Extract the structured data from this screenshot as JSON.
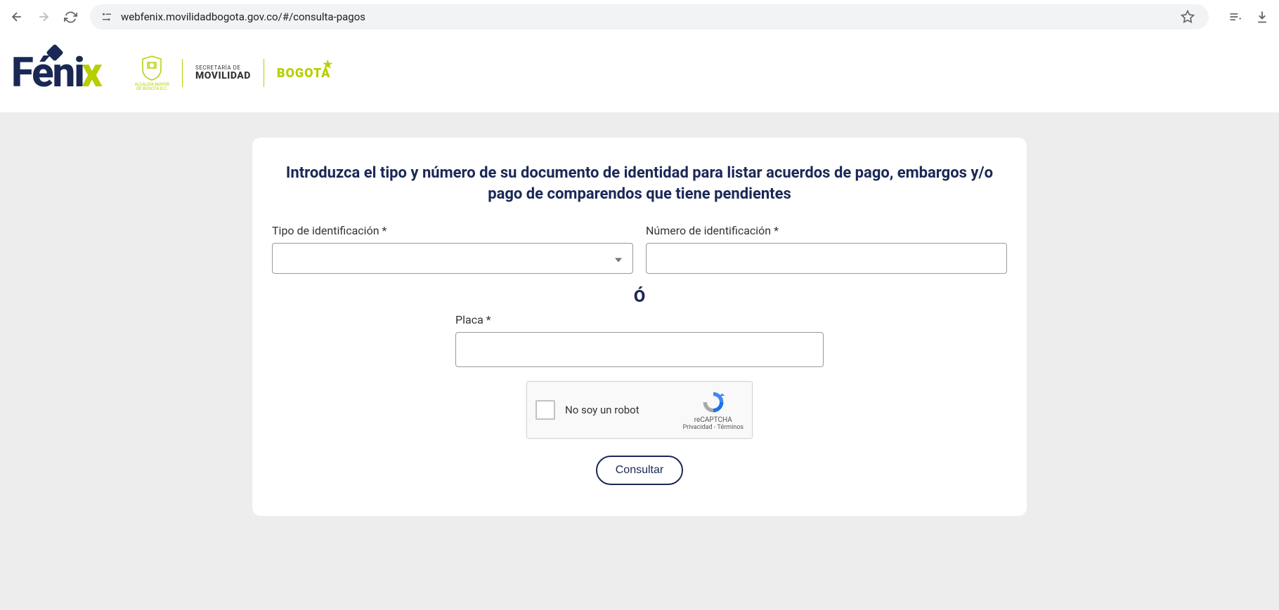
{
  "browser": {
    "url": "webfenix.movilidadbogota.gov.co/#/consulta-pagos"
  },
  "header": {
    "logo_text_1": "Féni",
    "logo_text_2": "x",
    "shield_line1": "ALCALDÍA MAYOR",
    "shield_line2": "DE BOGOTÁ D.C.",
    "movilidad_top": "SECRETARÍA DE",
    "movilidad_main": "MOVILIDAD",
    "bogota": "BOGOTÁ"
  },
  "form": {
    "title": "Introduzca el tipo y número de su documento de identidad para listar acuerdos de pago, embargos y/o pago de comparendos que tiene pendientes",
    "tipo_label": "Tipo de identificación *",
    "numero_label": "Número de identificación *",
    "separator": "Ó",
    "placa_label": "Placa *",
    "recaptcha_label": "No soy un robot",
    "recaptcha_brand": "reCAPTCHA",
    "recaptcha_privacy": "Privacidad",
    "recaptcha_terms": "Términos",
    "submit": "Consultar"
  }
}
